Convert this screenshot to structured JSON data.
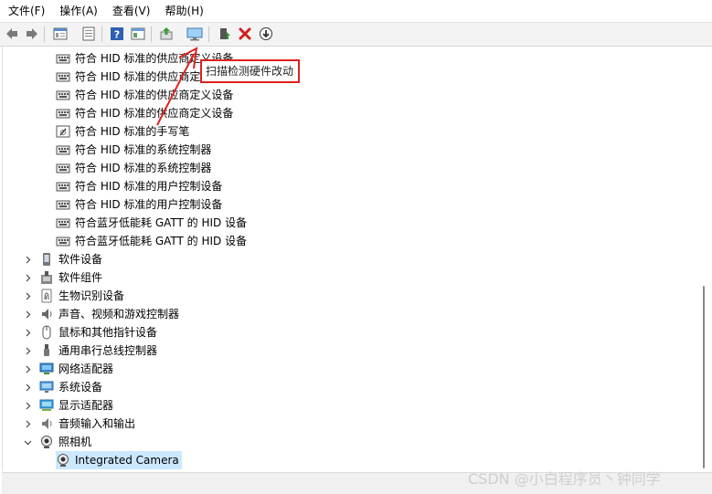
{
  "menubar": {
    "items": [
      "文件(F)",
      "操作(A)",
      "查看(V)",
      "帮助(H)"
    ]
  },
  "toolbar": {
    "buttons": [
      {
        "icon": "back-arrow-icon"
      },
      {
        "icon": "forward-arrow-icon"
      },
      {
        "icon": "properties-icon"
      },
      {
        "icon": "console-tree-icon"
      },
      {
        "icon": "help-icon"
      },
      {
        "icon": "view-icon"
      },
      {
        "icon": "update-driver-icon"
      },
      {
        "icon": "scan-hardware-icon"
      },
      {
        "icon": "enable-device-icon"
      },
      {
        "icon": "uninstall-x-icon"
      },
      {
        "icon": "download-driver-icon"
      }
    ],
    "tooltip": "扫描检测硬件改动"
  },
  "tree": {
    "hid_devices": [
      "符合 HID 标准的供应商定义设备",
      "符合 HID 标准的供应商定义设备",
      "符合 HID 标准的供应商定义设备",
      "符合 HID 标准的供应商定义设备",
      "符合 HID 标准的手写笔",
      "符合 HID 标准的系统控制器",
      "符合 HID 标准的系统控制器",
      "符合 HID 标准的用户控制设备",
      "符合 HID 标准的用户控制设备",
      "符合蓝牙低能耗 GATT 的 HID 设备",
      "符合蓝牙低能耗 GATT 的 HID 设备"
    ],
    "categories": [
      {
        "label": "软件设备",
        "icon": "software-device-icon",
        "expanded": false
      },
      {
        "label": "软件组件",
        "icon": "software-component-icon",
        "expanded": false
      },
      {
        "label": "生物识别设备",
        "icon": "fingerprint-icon",
        "expanded": false
      },
      {
        "label": "声音、视频和游戏控制器",
        "icon": "speaker-icon",
        "expanded": false
      },
      {
        "label": "鼠标和其他指针设备",
        "icon": "mouse-icon",
        "expanded": false
      },
      {
        "label": "通用串行总线控制器",
        "icon": "usb-icon",
        "expanded": false
      },
      {
        "label": "网络适配器",
        "icon": "network-adapter-icon",
        "expanded": false
      },
      {
        "label": "系统设备",
        "icon": "system-device-icon",
        "expanded": false
      },
      {
        "label": "显示适配器",
        "icon": "display-adapter-icon",
        "expanded": false
      },
      {
        "label": "音频输入和输出",
        "icon": "audio-io-icon",
        "expanded": false
      },
      {
        "label": "照相机",
        "icon": "camera-icon",
        "expanded": true
      }
    ],
    "camera_children": [
      "Integrated Camera"
    ]
  },
  "watermark": "CSDN @小白程序员丶钟同学",
  "colors": {
    "annotation_red": "#e02020",
    "selection": "#cce8ff",
    "toolbar_bg": "#f3f3f3"
  }
}
